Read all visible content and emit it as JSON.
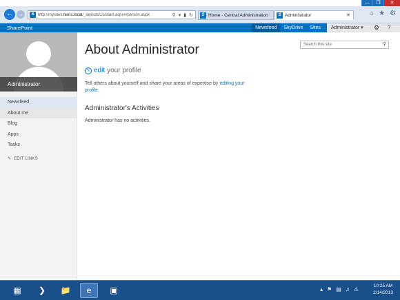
{
  "browser": {
    "url_prefix": "http://mysites.",
    "url_domain": "ferris.local",
    "url_suffix": "/_layouts/15/start.aspx#/person.aspx",
    "tabs": [
      {
        "label": "Home - Central Administration"
      },
      {
        "label": "Administrator"
      }
    ]
  },
  "suite": {
    "brand": "SharePoint",
    "links": [
      "Newsfeed",
      "SkyDrive",
      "Sites"
    ],
    "user": "Administrator ▾"
  },
  "profile": {
    "name": "Administrator"
  },
  "nav": {
    "items": [
      "Newsfeed",
      "About me",
      "Blog",
      "Apps",
      "Tasks"
    ],
    "edit_links": "EDIT LINKS"
  },
  "search": {
    "placeholder": "Search this site"
  },
  "main": {
    "title": "About Administrator",
    "edit_word": "edit",
    "edit_rest": "your profile",
    "tell_text": "Tell others about yourself and share your areas of expertise by ",
    "tell_link": "editing your profile",
    "tell_end": ".",
    "activities_title": "Administrator's Activities",
    "activities_empty": "Administrator has no activities."
  },
  "taskbar": {
    "time": "10:25 AM",
    "date": "2/14/2013"
  },
  "colors": {
    "accent": "#0072c6",
    "taskbar": "#1b4f8c"
  }
}
